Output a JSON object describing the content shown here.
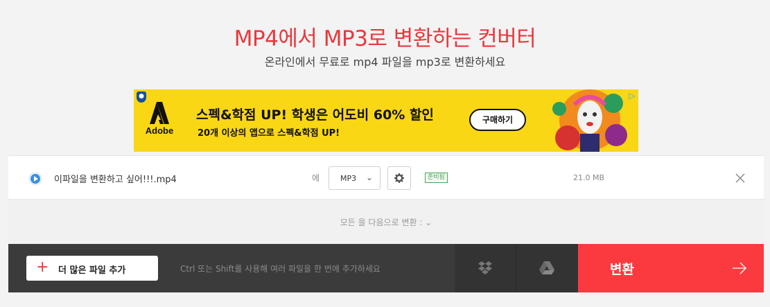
{
  "header": {
    "title": "MP4에서 MP3로 변환하는 컨버터",
    "subtitle": "온라인에서 무료로 mp4 파일을 mp3로 변환하세요"
  },
  "ad": {
    "brand": "Adobe",
    "headline": "스펙&학점 UP! 학생은 어도비 60% 할인",
    "subline": "20개 이상의 앱으로 스펙&학점 UP!",
    "cta": "구매하기",
    "background_color": "#f9d715"
  },
  "file": {
    "name": "이파일을 변환하고 싶어!!!.mp4",
    "to_label": "에",
    "format": "MP3",
    "status": "준비됨",
    "size": "21.0 MB"
  },
  "convert_all": {
    "label": "모든 을 다음으로 변환 :"
  },
  "toolbar": {
    "add_files_label": "더 많은 파일 추가",
    "hint": "Ctrl 또는 Shift를 사용해 여러 파일을 한 번에 추가하세요",
    "convert_label": "변환"
  },
  "colors": {
    "accent": "#e8383d",
    "convert_button": "#fa3a3f",
    "toolbar_bg": "#3b3b3b",
    "ready_badge": "#46a35a"
  },
  "icons": {
    "file": "play-circle-icon",
    "settings": "gear-icon",
    "remove": "close-icon",
    "add": "plus-icon",
    "dropbox": "dropbox-icon",
    "google_drive": "google-drive-icon",
    "convert": "arrow-right-icon"
  }
}
